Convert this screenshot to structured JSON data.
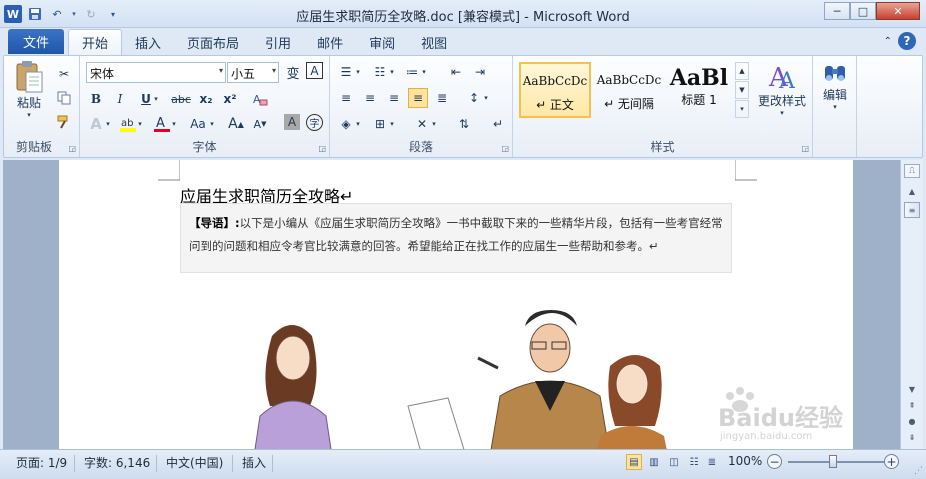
{
  "window": {
    "title": "应届生求职简历全攻略.doc [兼容模式]  -  Microsoft Word",
    "app_icon": "W",
    "controls": {
      "minimize": "─",
      "maximize": "□",
      "close": "✕"
    }
  },
  "tabs": {
    "file": "文件",
    "items": [
      "开始",
      "插入",
      "页面布局",
      "引用",
      "邮件",
      "审阅",
      "视图"
    ],
    "active": "开始"
  },
  "ribbon": {
    "clipboard": {
      "label": "剪贴板",
      "paste": "粘贴"
    },
    "font": {
      "label": "字体",
      "name": "宋体",
      "size": "小五",
      "bold": "B",
      "italic": "I",
      "underline": "U",
      "strike": "abc",
      "subscript": "x₂",
      "superscript": "x²",
      "grow": "A",
      "shrink": "A",
      "case": "Aa",
      "clear": "A",
      "char_border": "A",
      "enclose": "字",
      "pinyin": "变"
    },
    "paragraph": {
      "label": "段落"
    },
    "styles": {
      "label": "样式",
      "items": [
        {
          "sample": "AaBbCcDc",
          "name": "↵ 正文"
        },
        {
          "sample": "AaBbCcDc",
          "name": "↵ 无间隔"
        },
        {
          "sample": "AaBl",
          "name": "标题 1"
        }
      ],
      "change": "更改样式"
    },
    "editing": {
      "label": "编辑"
    }
  },
  "document": {
    "title": "应届生求职简历全攻略↵",
    "intro_label": "【导语】:",
    "intro_text": "以下是小编从《应届生求职简历全攻略》一书中截取下来的一些精华片段，包括有一些考官经常问到的问题和相应令考官比较满意的回答。希望能给正在找工作的应届生一些帮助和参考。↵"
  },
  "status": {
    "page": "页面: 1/9",
    "words": "字数: 6,146",
    "language": "中文(中国)",
    "mode": "插入",
    "zoom": "100%",
    "zoom_level": 100
  },
  "watermark": {
    "brand": "Baidu经验",
    "url": "jingyan.baidu.com"
  },
  "colors": {
    "file_tab": "#2b64b8",
    "highlight": "#ffff00",
    "font_color": "#e0001b",
    "selected_style": "#ffe39a"
  }
}
